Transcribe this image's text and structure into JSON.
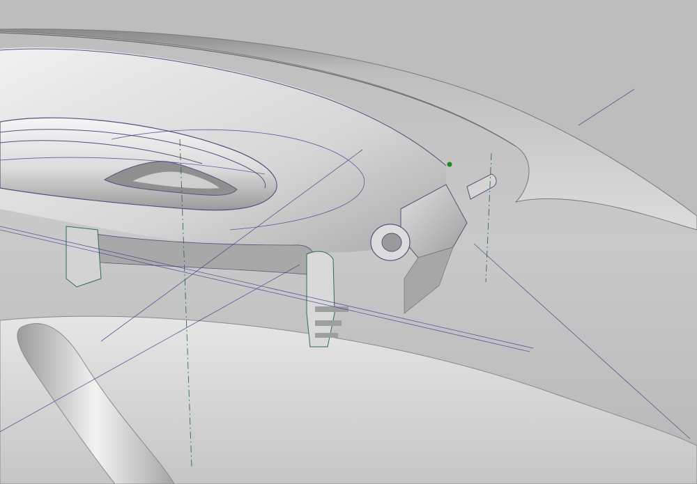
{
  "viewport": {
    "render_mode": "shaded-with-edges",
    "background_color": "#c4c4c4",
    "colors": {
      "surface_light": "#ececec",
      "surface_mid": "#cfcfcf",
      "surface_dark": "#8e8e8e",
      "edge_line": "#5b4f7a",
      "construction_line": "#3d3d8a",
      "centerline": "#2f6b5a",
      "selection_point": "#1f8a1f"
    },
    "model": {
      "name": "",
      "components": [
        "outer-shell-surface",
        "inner-recess-surface",
        "handle-lever",
        "handle-grip-slot",
        "mounting-bracket-left",
        "mounting-bracket-right",
        "hinge-pin",
        "hinge-block",
        "lower-trim-groove"
      ]
    }
  }
}
